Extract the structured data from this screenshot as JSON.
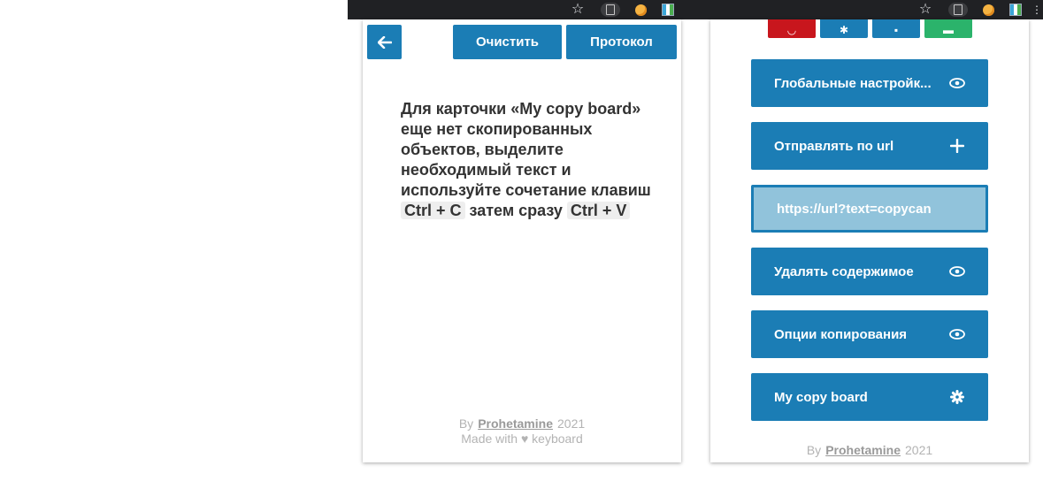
{
  "left_popup": {
    "clear_label": "Очистить",
    "log_label": "Протокол",
    "message_part1": "Для карточки «",
    "message_board": "My copy board",
    "message_part2": "» еще нет скопированных объектов, выделите необходимый текст и используйте сочетание клавиш ",
    "shortcut_copy": "Ctrl + C",
    "message_part3": " затем сразу ",
    "shortcut_paste": "Ctrl + V",
    "footer_by": "By",
    "footer_author": "Prohetamine",
    "footer_year": "2021",
    "footer_made_with": "Made with",
    "footer_keyboard": "keyboard"
  },
  "right_popup": {
    "menu": [
      {
        "label": "Глобальные настройк...",
        "icon": "eye-icon"
      },
      {
        "label": "Отправлять по url",
        "icon": "plus-icon"
      }
    ],
    "url_value": "https://url?text=copycan",
    "menu2": [
      {
        "label": "Удалять содержимое",
        "icon": "eye-icon"
      },
      {
        "label": "Опции копирования",
        "icon": "eye-icon"
      },
      {
        "label": "My copy board",
        "icon": "gear-icon"
      }
    ],
    "footer_by": "By",
    "footer_author": "Prohetamine",
    "footer_year": "2021"
  },
  "colors": {
    "primary": "#1b7db5",
    "danger": "#c8161d",
    "success": "#2bb36b",
    "url_bg": "#91c3db"
  }
}
